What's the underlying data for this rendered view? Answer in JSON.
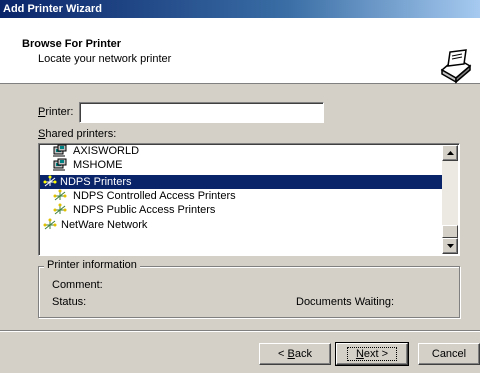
{
  "window": {
    "title": "Add Printer Wizard"
  },
  "header": {
    "title": "Browse For Printer",
    "subtitle": "Locate your network printer",
    "icon": "printer-wizard-icon"
  },
  "printer_field": {
    "label_accel": "P",
    "label_rest": "rinter:",
    "value": ""
  },
  "shared_printers": {
    "label_accel": "S",
    "label_rest": "hared printers:",
    "items": [
      {
        "label": "AXISWORLD",
        "icon": "workgroup-icon",
        "selected": false
      },
      {
        "label": "MSHOME",
        "icon": "workgroup-icon",
        "selected": false
      },
      {
        "label": "NDPS Printers",
        "icon": "network-tree-icon",
        "selected": true
      },
      {
        "label": "NDPS Controlled Access Printers",
        "icon": "network-tree-icon",
        "selected": false
      },
      {
        "label": "NDPS Public Access Printers",
        "icon": "network-tree-icon",
        "selected": false
      },
      {
        "label": "NetWare Network",
        "icon": "network-tree-icon",
        "selected": false
      }
    ]
  },
  "printer_info": {
    "legend": "Printer information",
    "comment_label": "Comment:",
    "status_label": "Status:",
    "documents_waiting_label": "Documents Waiting:"
  },
  "buttons": {
    "back": {
      "accel": "B",
      "prefix": "< ",
      "rest": "ack"
    },
    "next": {
      "accel": "N",
      "rest": "ext >"
    },
    "cancel": "Cancel"
  },
  "colors": {
    "selection": "#0a246a",
    "face": "#d4d0c8",
    "title_gradient_start": "#0a246a"
  }
}
